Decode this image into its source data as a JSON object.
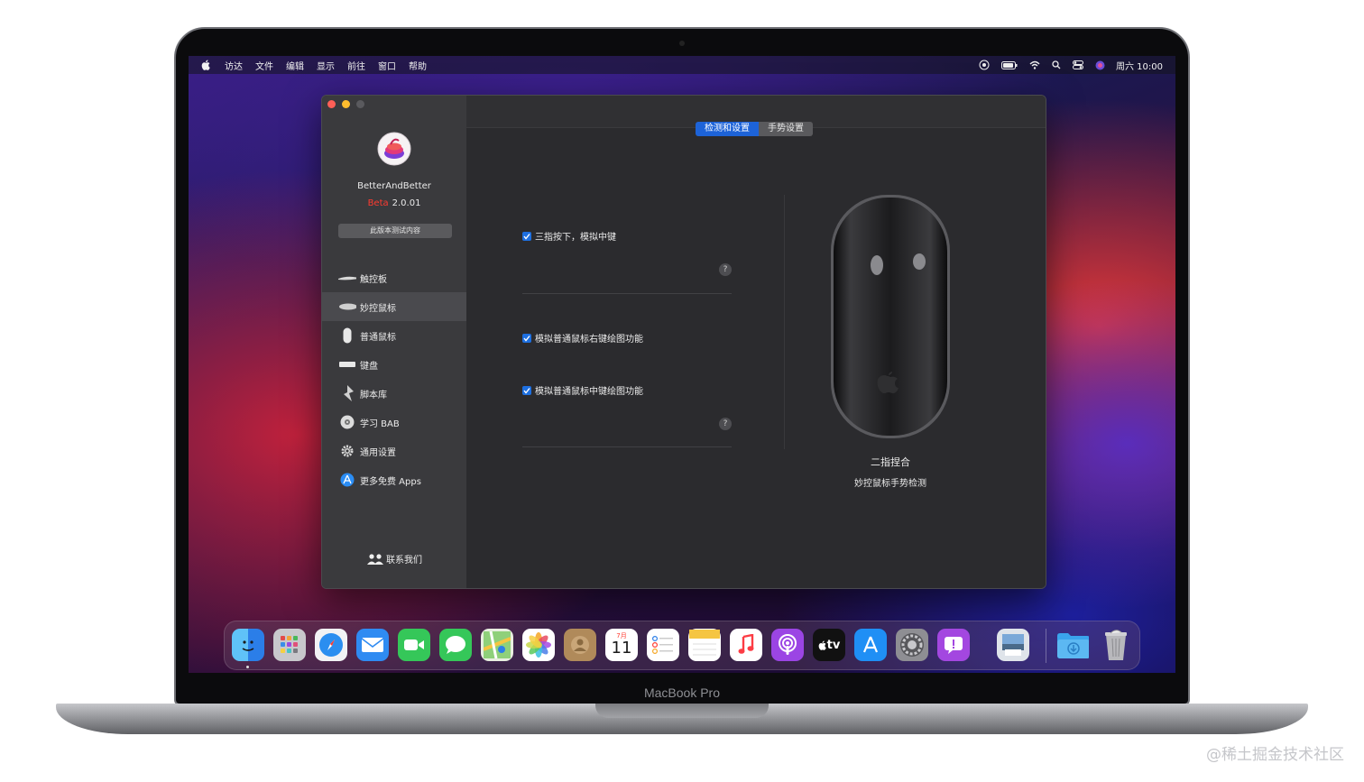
{
  "menubar": {
    "items": [
      "访达",
      "文件",
      "编辑",
      "显示",
      "前往",
      "窗口",
      "帮助"
    ],
    "clock": "周六 10:00"
  },
  "app": {
    "name": "BetterAndBetter",
    "beta_label": "Beta",
    "version": "2.0.01",
    "test_button": "此版本测试内容"
  },
  "sidebar": {
    "items": [
      {
        "label": "触控板",
        "icon": "trackpad-icon"
      },
      {
        "label": "妙控鼠标",
        "icon": "magic-mouse-icon",
        "active": true
      },
      {
        "label": "普通鼠标",
        "icon": "mouse-icon"
      },
      {
        "label": "键盘",
        "icon": "keyboard-icon"
      },
      {
        "label": "脚本库",
        "icon": "script-icon"
      },
      {
        "label": "学习 BAB",
        "icon": "learn-icon"
      },
      {
        "label": "通用设置",
        "icon": "gear-icon"
      },
      {
        "label": "更多免费 Apps",
        "icon": "app-store-icon"
      }
    ],
    "contact": "联系我们"
  },
  "tabs": [
    {
      "label": "检测和设置",
      "active": true
    },
    {
      "label": "手势设置",
      "active": false
    }
  ],
  "settings": {
    "opt1": "三指按下，模拟中键",
    "opt2": "模拟普通鼠标右键绘图功能",
    "opt3": "模拟普通鼠标中键绘图功能",
    "help": "?"
  },
  "detection": {
    "gesture": "二指捏合",
    "caption": "妙控鼠标手势检测"
  },
  "dock": {
    "calendar_month": "7月",
    "calendar_day": "11",
    "tv_label": "tv"
  },
  "device": {
    "label": "MacBook Pro"
  },
  "watermark": "@稀土掘金技术社区",
  "colors": {
    "accent": "#1d63d8",
    "beta": "#ff3b30",
    "window_bg": "#2b2b2e",
    "sidebar_bg": "#3a3a3d"
  }
}
